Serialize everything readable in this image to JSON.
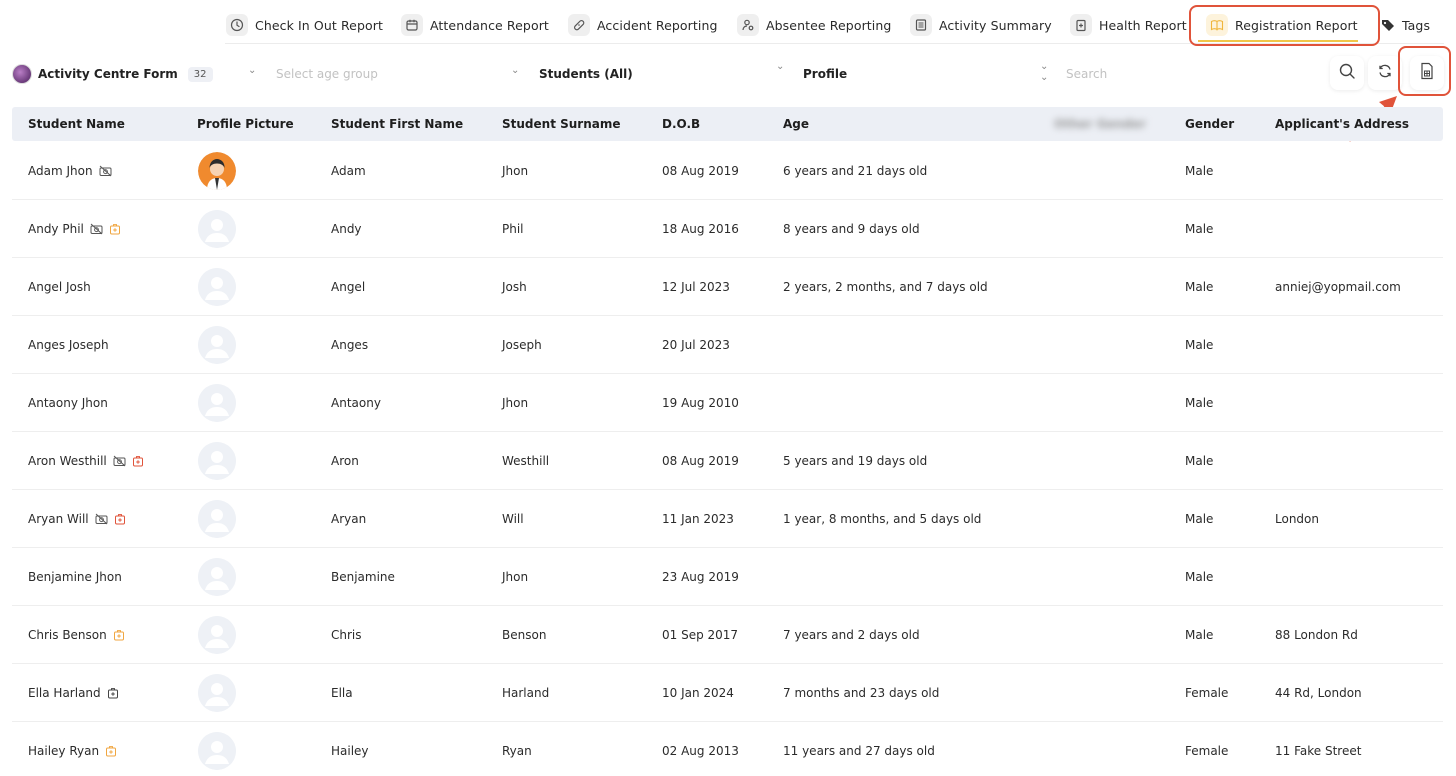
{
  "tabs": [
    {
      "label": "Check In Out Report",
      "icon": "clock-icon"
    },
    {
      "label": "Attendance Report",
      "icon": "calendar-icon"
    },
    {
      "label": "Accident Reporting",
      "icon": "bandage-icon"
    },
    {
      "label": "Absentee Reporting",
      "icon": "user-gear-icon"
    },
    {
      "label": "Activity Summary",
      "icon": "list-icon"
    },
    {
      "label": "Health Report",
      "icon": "clipboard-icon"
    },
    {
      "label": "Registration Report",
      "icon": "book-icon"
    },
    {
      "label": "Tags",
      "icon": "tag-icon"
    }
  ],
  "active_tab": "Registration Report",
  "filters": {
    "form_name": "Activity Centre Form",
    "form_count": "32",
    "age_group_placeholder": "Select age group",
    "students": "Students (All)",
    "profile": "Profile",
    "search_placeholder": "Search"
  },
  "table": {
    "columns": [
      "Student Name",
      "Profile Picture",
      "Student First Name",
      "Student Surname",
      "D.O.B",
      "Age",
      "Other Gender",
      "Gender",
      "Applicant's Address"
    ],
    "rows": [
      {
        "name": "Adam Jhon",
        "first": "Adam",
        "surname": "Jhon",
        "dob": "08 Aug 2019",
        "age": "6 years and 21 days old",
        "gender": "Male",
        "address": "",
        "icons": [
          "no-photo"
        ],
        "photo": true
      },
      {
        "name": "Andy Phil",
        "first": "Andy",
        "surname": "Phil",
        "dob": "18 Aug 2016",
        "age": "8 years and 9 days old",
        "gender": "Male",
        "address": "",
        "icons": [
          "no-photo",
          "medical-orange"
        ],
        "photo": false
      },
      {
        "name": "Angel Josh",
        "first": "Angel",
        "surname": "Josh",
        "dob": "12 Jul 2023",
        "age": "2 years, 2 months, and 7 days old",
        "gender": "Male",
        "address": "anniej@yopmail.com",
        "icons": [],
        "photo": false
      },
      {
        "name": "Anges Joseph",
        "first": "Anges",
        "surname": "Joseph",
        "dob": "20 Jul 2023",
        "age": "",
        "gender": "Male",
        "address": "",
        "icons": [],
        "photo": false
      },
      {
        "name": "Antaony Jhon",
        "first": "Antaony",
        "surname": "Jhon",
        "dob": "19 Aug 2010",
        "age": "",
        "gender": "Male",
        "address": "",
        "icons": [],
        "photo": false
      },
      {
        "name": "Aron Westhill",
        "first": "Aron",
        "surname": "Westhill",
        "dob": "08 Aug 2019",
        "age": "5 years and 19 days old",
        "gender": "Male",
        "address": "",
        "icons": [
          "no-photo",
          "medical-red"
        ],
        "photo": false
      },
      {
        "name": "Aryan Will",
        "first": "Aryan",
        "surname": "Will",
        "dob": "11 Jan 2023",
        "age": "1 year, 8 months, and 5 days old",
        "gender": "Male",
        "address": "London",
        "icons": [
          "no-photo",
          "medical-red"
        ],
        "photo": false
      },
      {
        "name": "Benjamine Jhon",
        "first": "Benjamine",
        "surname": "Jhon",
        "dob": "23 Aug 2019",
        "age": "",
        "gender": "Male",
        "address": "",
        "icons": [],
        "photo": false
      },
      {
        "name": "Chris Benson",
        "first": "Chris",
        "surname": "Benson",
        "dob": "01 Sep 2017",
        "age": "7 years and 2 days old",
        "gender": "Male",
        "address": "88 London Rd",
        "icons": [
          "medical-orange"
        ],
        "photo": false
      },
      {
        "name": "Ella Harland",
        "first": "Ella",
        "surname": "Harland",
        "dob": "10 Jan 2024",
        "age": "7 months and 23 days old",
        "gender": "Female",
        "address": "44 Rd, London",
        "icons": [
          "medical-dark"
        ],
        "photo": false
      },
      {
        "name": "Hailey Ryan",
        "first": "Hailey",
        "surname": "Ryan",
        "dob": "02 Aug 2013",
        "age": "11 years and 27 days old",
        "gender": "Female",
        "address": "11 Fake Street",
        "icons": [
          "medical-orange"
        ],
        "photo": false
      }
    ]
  },
  "colors": {
    "highlight": "#e0533a",
    "active_tab_underline": "#f0c64a",
    "header_bg": "#eceff5",
    "medical_orange": "#f0a640",
    "medical_red": "#e0533a"
  }
}
